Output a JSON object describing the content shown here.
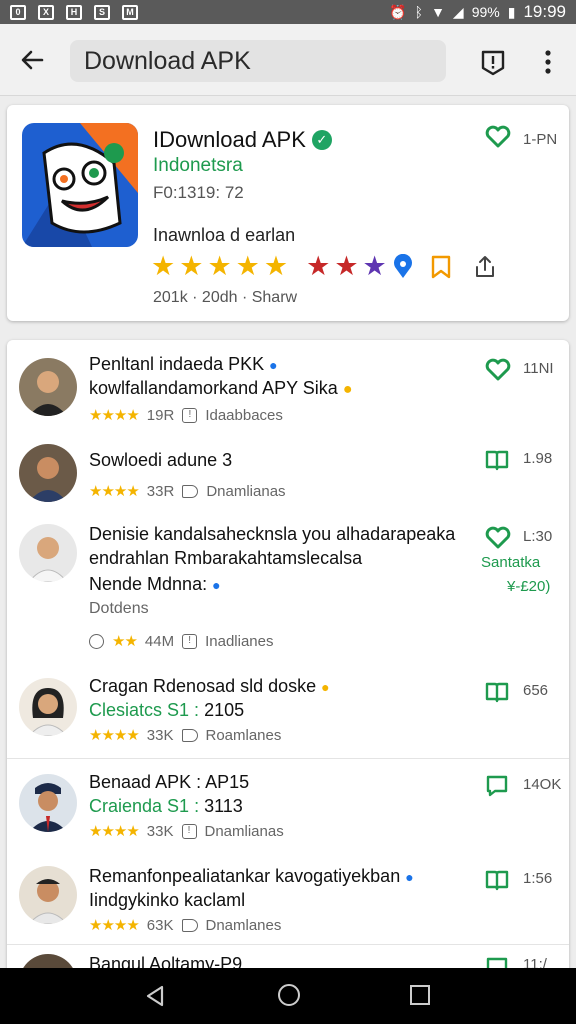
{
  "status_bar": {
    "left_icons": [
      "0",
      "X",
      "H",
      "S",
      "M"
    ],
    "battery": "99%",
    "time": "19:99"
  },
  "app_bar": {
    "search_value": "Download APK",
    "icons": [
      "back-arrow-icon",
      "shield-alert-icon",
      "more-vert-icon"
    ]
  },
  "header": {
    "title": "IDownload APK",
    "subtitle": "Indonetsra",
    "version": "F0:1319: 72",
    "description": "Inawnloa d earlan",
    "meta": "201k · 20dh · Sharw",
    "badge": "1-PN",
    "colors": {
      "green": "#1e9a4e",
      "star_yellow": "#f4b400",
      "star_red": "#c62828",
      "star_purple": "#5e35b1",
      "pin_blue": "#1a73e8",
      "bookmark_orange": "#f29900"
    }
  },
  "list": [
    {
      "line1": "Penltanl indaeda PKK",
      "line2": "kowlfallandamorkand APY Sika",
      "stars": "★★★★",
      "count": "19R",
      "tag": "Idaabbaces",
      "right": "11NI"
    },
    {
      "line1": "Sowloedi adune 3",
      "stars": "★★★★",
      "count": "33R",
      "tag": "Dnamlianas",
      "right": "1.98"
    },
    {
      "line1": "Denisie kandalsahecknsla you alhadarapeaka",
      "line2": "endrahlan Rmbarakahtamslecalsa",
      "line3": "Nende Mdnna:",
      "line4": "Dotdens",
      "stars": "★★",
      "count": "44M",
      "tag": "Inadlianes",
      "right": "L:30",
      "side1": "Santatka",
      "side2": "¥-£20)"
    },
    {
      "line1": "Cragan Rdenosad sld doske",
      "line2_green": "Clesiatcs S1 :",
      "line2_rest": "2105",
      "stars": "★★★★",
      "count": "33K",
      "tag": "Roamlanes",
      "right": "656"
    },
    {
      "line1": "Benaad APK : AP15",
      "line2_green": "Craiendа S1 :",
      "line2_rest": "3113",
      "stars": "★★★★",
      "count": "33K",
      "tag": "Dnamlianas",
      "right": "14OK"
    },
    {
      "line1": "Remanfonpealiatankar kavogatiyekban",
      "line2": "Iindgykinko kaclaml",
      "stars": "★★★★",
      "count": "63K",
      "tag": "Dnamlanes",
      "right": "1:56"
    },
    {
      "line1": "Bangul Aoltamy-P9",
      "right": "11:/"
    }
  ]
}
